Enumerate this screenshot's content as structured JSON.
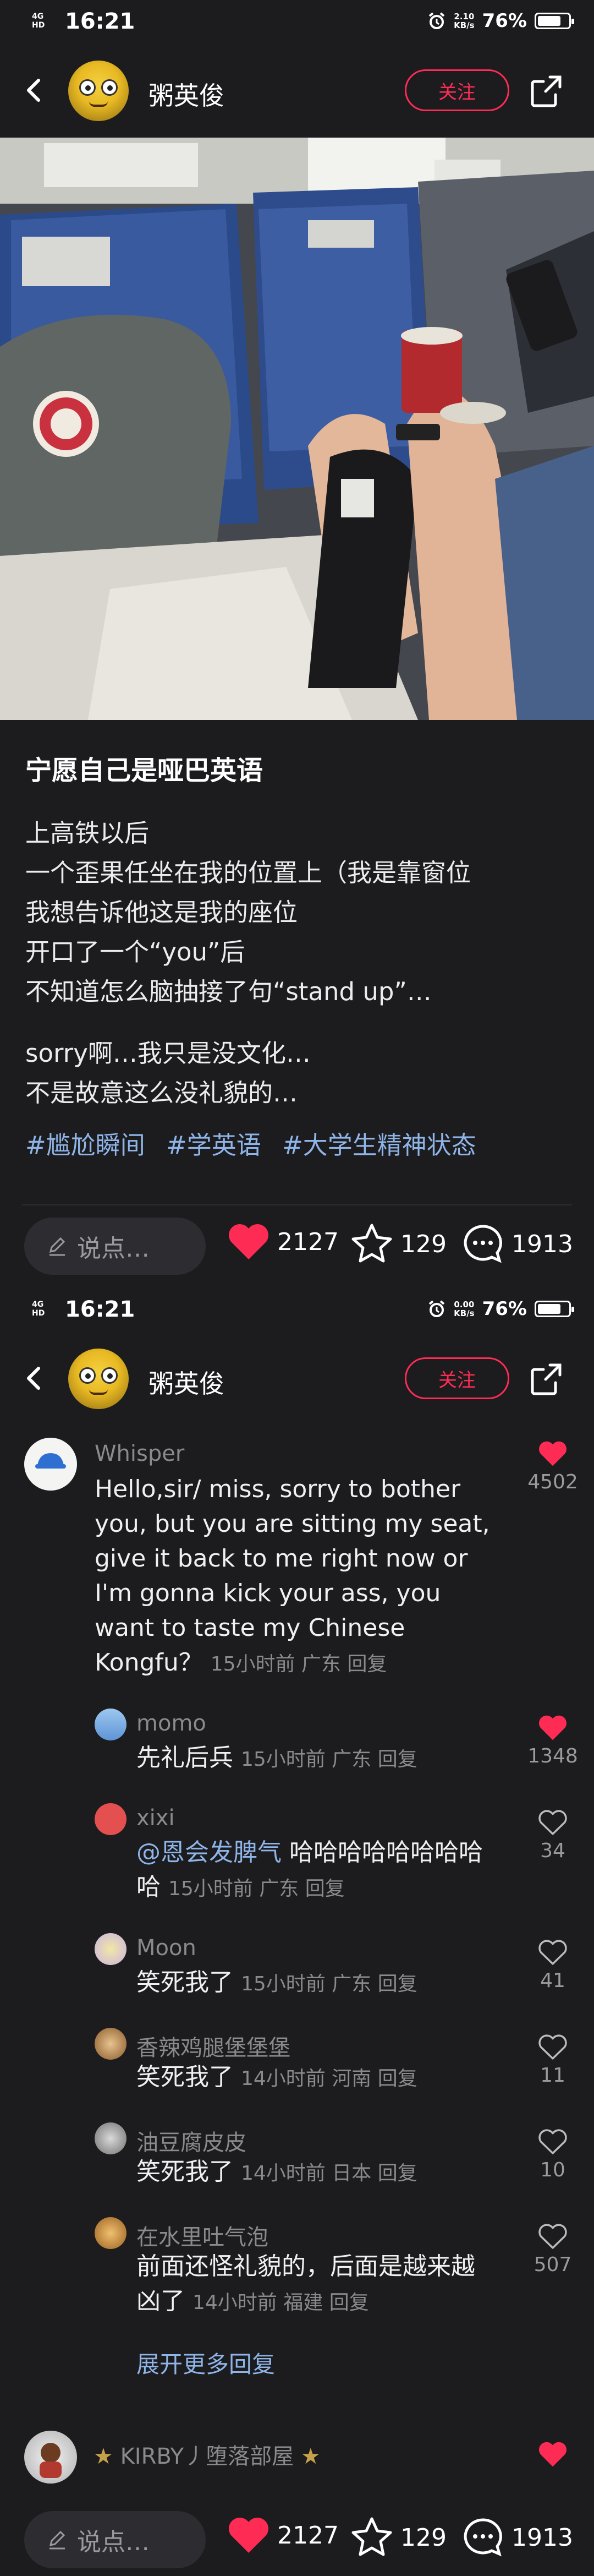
{
  "status_bar": {
    "network_top": "4G",
    "network_bottom": "HD",
    "time": "16:21",
    "speed_top_1": "2.10",
    "speed_top_2": "0.00",
    "speed_unit": "KB/s",
    "battery": "76%",
    "battery_level": 0.76
  },
  "header": {
    "username": "粥英俊",
    "follow_label": "关注"
  },
  "post": {
    "title": "宁愿自己是哑巴英语",
    "lines": [
      "上高铁以后",
      "一个歪果任坐在我的位置上（我是靠窗位",
      "我想告诉他这是我的座位",
      "开口了一个“you”后",
      "不知道怎么脑抽接了句“stand up”…",
      "sorry啊…我只是没文化…",
      "不是故意这么没礼貌的…"
    ],
    "tags": [
      "#尴尬瞬间",
      "#学英语",
      "#大学生精神状态"
    ]
  },
  "action_bar": {
    "say_placeholder": "说点…",
    "likes": "2127",
    "favorites": "129",
    "comments": "1913"
  },
  "comments": {
    "main": {
      "name": "Whisper",
      "text": [
        "Hello,sir/ miss, sorry to bother",
        "you, but you are sitting my seat,",
        "give it back to me right now or",
        "I'm gonna kick your ass, you",
        "want to taste my Chinese"
      ],
      "last_line": "Kongfu？",
      "meta": "15小时前  广东  回复",
      "likes": "4502"
    },
    "replies": [
      {
        "name": "momo",
        "text": "先礼后兵",
        "meta": "15小时前  广东  回复",
        "likes": "1348",
        "liked": true
      },
      {
        "name": "xixi",
        "mention": "@恩会发脾气",
        "text_a": " 哈哈哈哈哈哈哈哈",
        "text_b": "哈",
        "meta": "15小时前  广东  回复",
        "likes": "34",
        "liked": false
      },
      {
        "name": "Moon",
        "text": "笑死我了",
        "meta": "15小时前  广东  回复",
        "likes": "41",
        "liked": false
      },
      {
        "name": "香辣鸡腿堡堡堡",
        "text": "笑死我了",
        "meta": "14小时前  河南  回复",
        "likes": "11",
        "liked": false
      },
      {
        "name": "油豆腐皮皮",
        "text": "笑死我了",
        "meta": "14小时前  日本  回复",
        "likes": "10",
        "liked": false
      },
      {
        "name": "在水里吐气泡",
        "text_a": "前面还怪礼貌的，后面是越来越",
        "text_b": "凶了",
        "meta": "14小时前  福建  回复",
        "likes": "507",
        "liked": false
      }
    ],
    "show_more": "展开更多回复",
    "next": {
      "name": "KIRBY丿堕落部屋"
    }
  },
  "colors": {
    "accent": "#fe2c55",
    "link": "#8eb4e8",
    "muted": "#8a8a8e",
    "background": "#1c1c1e"
  },
  "icons": [
    "back-icon",
    "share-icon",
    "pencil-icon",
    "heart-icon",
    "star-icon",
    "comment-icon",
    "alarm-icon"
  ]
}
